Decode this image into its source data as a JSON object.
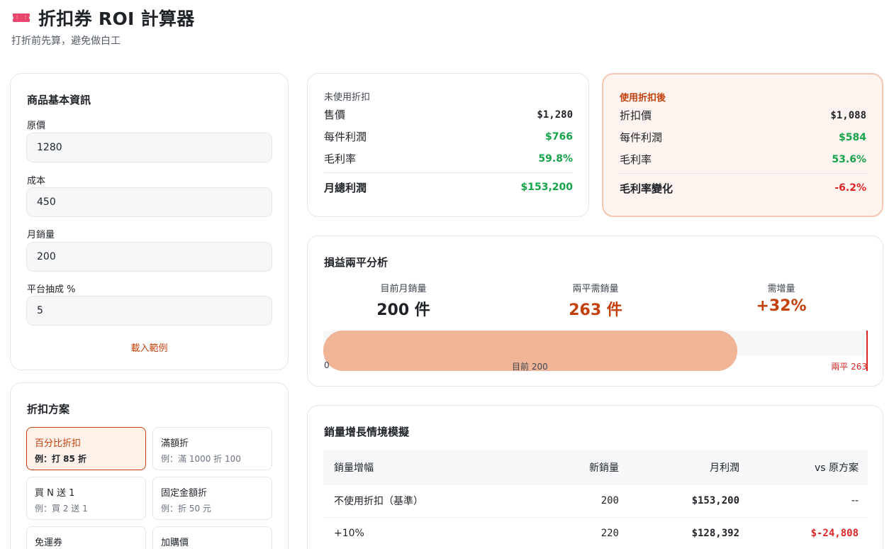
{
  "header": {
    "icon": "ticket-icon",
    "title": "折扣券 ROI 計算器",
    "subtitle": "打折前先算，避免做白工"
  },
  "basic_info": {
    "title": "商品基本資訊",
    "fields": [
      {
        "label": "原價",
        "value": "1280"
      },
      {
        "label": "成本",
        "value": "450"
      },
      {
        "label": "月銷量",
        "value": "200"
      },
      {
        "label": "平台抽成 %",
        "value": "5"
      }
    ],
    "load_example": "載入範例"
  },
  "plans": {
    "title": "折扣方案",
    "items": [
      {
        "name": "百分比折扣",
        "example": "例：打 85 折",
        "selected": true
      },
      {
        "name": "滿額折",
        "example": "例：滿 1000 折 100",
        "selected": false
      },
      {
        "name": "買 N 送 1",
        "example": "例：買 2 送 1",
        "selected": false
      },
      {
        "name": "固定金額折",
        "example": "例：折 50 元",
        "selected": false
      },
      {
        "name": "免運券",
        "example": "",
        "selected": false
      },
      {
        "name": "加購價",
        "example": "",
        "selected": false
      }
    ]
  },
  "before": {
    "heading": "未使用折扣",
    "rows": [
      {
        "label": "售價",
        "value": "$1,280"
      },
      {
        "label": "每件利潤",
        "value": "$766"
      },
      {
        "label": "毛利率",
        "value": "59.8%"
      }
    ],
    "total_label": "月總利潤",
    "total_value": "$153,200"
  },
  "after": {
    "heading": "使用折扣後",
    "rows": [
      {
        "label": "折扣價",
        "value": "$1,088"
      },
      {
        "label": "每件利潤",
        "value": "$584"
      },
      {
        "label": "毛利率",
        "value": "53.6%"
      }
    ],
    "total_label": "毛利率變化",
    "total_value": "-6.2%"
  },
  "breakeven": {
    "title": "損益兩平分析",
    "stats": [
      {
        "label": "目前月銷量",
        "value": "200 件"
      },
      {
        "label": "兩平需銷量",
        "value": "263 件"
      },
      {
        "label": "需增量",
        "value": "+32%"
      }
    ],
    "current_sales": 200,
    "breakeven_sales": 263,
    "axis_start": "0",
    "axis_current": "目前 200",
    "axis_end": "兩平 263",
    "colors": {
      "dark": "#1f2328",
      "accent": "#c2410c",
      "warn": "#c2410c",
      "fill": "#f0b496",
      "marker": "#dc2626"
    }
  },
  "growth": {
    "title": "銷量增長情境模擬",
    "columns": [
      "銷量增幅",
      "新銷量",
      "月利潤",
      "vs 原方案"
    ],
    "rows": [
      {
        "label": "不使用折扣（基準）",
        "qty": "200",
        "profit": "$153,200",
        "diff": "--"
      },
      {
        "label": "+10%",
        "qty": "220",
        "profit": "$128,392",
        "diff": "$-24,808"
      }
    ]
  }
}
